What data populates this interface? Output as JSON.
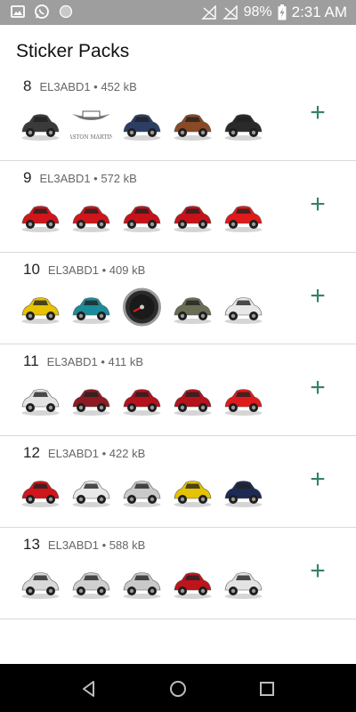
{
  "status_bar": {
    "battery": "98%",
    "time": "2:31 AM",
    "left_icons": [
      "image-icon",
      "whatsapp-icon",
      "circle-icon"
    ],
    "right_icons": [
      "no-signal-icon",
      "no-signal-icon",
      "battery-charging-icon"
    ]
  },
  "page": {
    "title": "Sticker Packs"
  },
  "colors": {
    "accent": "#37806d",
    "status_bar": "#9e9e9e",
    "nav_bar": "#000000"
  },
  "packs": [
    {
      "number": "8",
      "meta": "EL3ABD1 • 452 kB",
      "add_label": "+",
      "stickers": [
        {
          "icon": "dark-sedan-sticker",
          "color": "#3a3a3a"
        },
        {
          "icon": "aston-martin-logo-sticker",
          "color": "#666666",
          "text": "ASTON MARTIN"
        },
        {
          "icon": "blue-coupe-sticker",
          "color": "#2c3e66"
        },
        {
          "icon": "bronze-coupe-sticker",
          "color": "#8a4a26"
        },
        {
          "icon": "black-coupe-sticker",
          "color": "#2a2a2a"
        }
      ]
    },
    {
      "number": "9",
      "meta": "EL3ABD1 • 572 kB",
      "add_label": "+",
      "stickers": [
        {
          "icon": "red-sportscar-sticker",
          "color": "#d0151b"
        },
        {
          "icon": "red-sportscar-sticker",
          "color": "#d0151b"
        },
        {
          "icon": "red-supercar-sticker",
          "color": "#c8121a"
        },
        {
          "icon": "red-supercar-sticker",
          "color": "#c8121a"
        },
        {
          "icon": "red-convertible-sticker",
          "color": "#e01a1a"
        }
      ]
    },
    {
      "number": "10",
      "meta": "EL3ABD1 • 409 kB",
      "add_label": "+",
      "stickers": [
        {
          "icon": "yellow-hatchback-sticker",
          "color": "#e6c200"
        },
        {
          "icon": "teal-suv-sticker",
          "color": "#1c8c9a"
        },
        {
          "icon": "speedometer-sticker",
          "color": "#555555"
        },
        {
          "icon": "olive-suv-sticker",
          "color": "#6a6e55"
        },
        {
          "icon": "white-hatchback-sticker",
          "color": "#e8e8e8"
        }
      ]
    },
    {
      "number": "11",
      "meta": "EL3ABD1 • 411 kB",
      "add_label": "+",
      "stickers": [
        {
          "icon": "white-suv-sticker",
          "color": "#e3e3e3"
        },
        {
          "icon": "maroon-hatchback-sticker",
          "color": "#8e1a22"
        },
        {
          "icon": "red-coupe-sticker",
          "color": "#b5121b"
        },
        {
          "icon": "red-coupe-sticker",
          "color": "#b5121b"
        },
        {
          "icon": "red-convertible-sticker",
          "color": "#e01a1a"
        }
      ]
    },
    {
      "number": "12",
      "meta": "EL3ABD1 • 422 kB",
      "add_label": "+",
      "stickers": [
        {
          "icon": "red-supercar-sticker",
          "color": "#d0151b"
        },
        {
          "icon": "white-hatchback-sticker",
          "color": "#e8e8e8"
        },
        {
          "icon": "silver-sedan-sticker",
          "color": "#c9c9c9"
        },
        {
          "icon": "yellow-coupe-sticker",
          "color": "#e6c200"
        },
        {
          "icon": "navy-suv-sticker",
          "color": "#1d2a55"
        }
      ]
    },
    {
      "number": "13",
      "meta": "EL3ABD1 • 588 kB",
      "add_label": "+",
      "stickers": [
        {
          "icon": "silver-sportscar-sticker",
          "color": "#d9d9d9"
        },
        {
          "icon": "silver-sedan-front-sticker",
          "color": "#cfcfcf"
        },
        {
          "icon": "silver-sedan-sticker",
          "color": "#c9c9c9"
        },
        {
          "icon": "red-sedan-sticker",
          "color": "#c0141c"
        },
        {
          "icon": "white-suv-sticker",
          "color": "#e3e3e3"
        }
      ]
    }
  ],
  "nav_bar": {
    "buttons": [
      "back-icon",
      "home-icon",
      "recents-icon"
    ]
  }
}
